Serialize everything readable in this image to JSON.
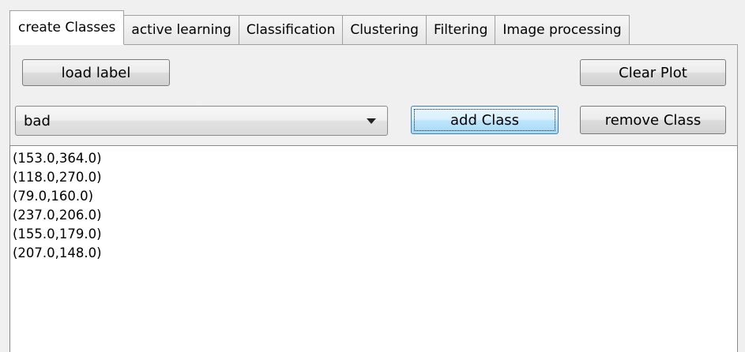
{
  "tabs": [
    {
      "label": "create Classes",
      "active": true
    },
    {
      "label": "active learning",
      "active": false
    },
    {
      "label": "Classification",
      "active": false
    },
    {
      "label": "Clustering",
      "active": false
    },
    {
      "label": "Filtering",
      "active": false
    },
    {
      "label": "Image processing",
      "active": false
    }
  ],
  "toolbar": {
    "load_label": "load label",
    "clear_plot": "Clear Plot",
    "add_class": "add Class",
    "remove_class": "remove Class"
  },
  "class_select": {
    "selected": "bad"
  },
  "points": [
    "(153.0,364.0)",
    "(118.0,270.0)",
    "(79.0,160.0)",
    "(237.0,206.0)",
    "(155.0,179.0)",
    "(207.0,148.0)"
  ]
}
